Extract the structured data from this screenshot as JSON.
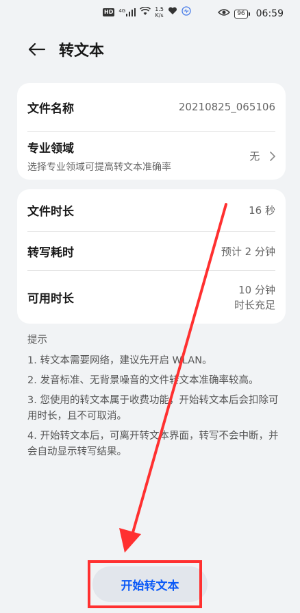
{
  "status_bar": {
    "hd": "HD",
    "signal": "4G",
    "speed_value": "1.5",
    "speed_unit": "K/s",
    "battery": "96",
    "time": "06:59"
  },
  "header": {
    "title": "转文本"
  },
  "file_card": {
    "file_name_label": "文件名称",
    "file_name_value": "20210825_065106",
    "domain_label": "专业领域",
    "domain_sublabel": "选择专业领域可提高转文本准确率",
    "domain_value": "无"
  },
  "duration_card": {
    "file_duration_label": "文件时长",
    "file_duration_value": "16 秒",
    "transcribe_time_label": "转写耗时",
    "transcribe_time_value": "预计 2 分钟",
    "available_label": "可用时长",
    "available_value": "10 分钟",
    "available_status": "时长充足"
  },
  "tips": {
    "title": "提示",
    "items": [
      "1. 转文本需要网络，建议先开启 WLAN。",
      "2. 发音标准、无背景噪音的文件转文本准确率较高。",
      "3. 您使用的转文本属于收费功能，开始转文本后会扣除可用时长，且不可取消。",
      "4. 开始转文本后，可离开转文本界面，转写不会中断，并会自动显示转写结果。"
    ]
  },
  "actions": {
    "start_label": "开始转文本"
  },
  "colors": {
    "accent": "#0a59f7",
    "annotation": "#ff3030"
  }
}
